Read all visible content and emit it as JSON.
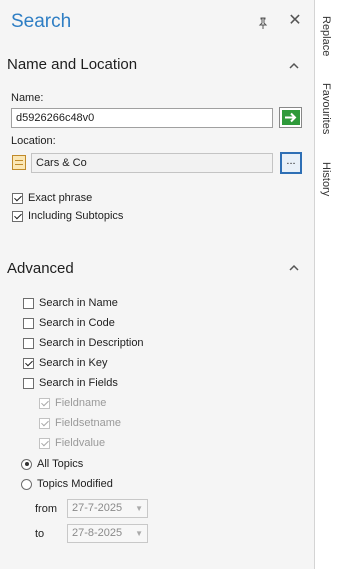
{
  "panel": {
    "title": "Search",
    "pin_icon": "pin-icon",
    "close_icon": "close-icon"
  },
  "side_tabs": [
    "Replace",
    "Favourites",
    "History"
  ],
  "name_location": {
    "heading": "Name and Location",
    "name_label": "Name:",
    "name_value": "d5926266c48v0",
    "location_label": "Location:",
    "location_value": "Cars & Co",
    "browse_label": "...",
    "options": [
      {
        "label": "Exact phrase",
        "checked": true
      },
      {
        "label": "Including Subtopics",
        "checked": true
      }
    ]
  },
  "advanced": {
    "heading": "Advanced",
    "search_in": [
      {
        "label": "Search in Name",
        "checked": false
      },
      {
        "label": "Search in Code",
        "checked": false
      },
      {
        "label": "Search in Description",
        "checked": false
      },
      {
        "label": "Search in Key",
        "checked": true
      },
      {
        "label": "Search in Fields",
        "checked": false
      }
    ],
    "fields": [
      {
        "label": "Fieldname",
        "checked": true
      },
      {
        "label": "Fieldsetname",
        "checked": true
      },
      {
        "label": "Fieldvalue",
        "checked": true
      }
    ],
    "topics": [
      {
        "label": "All Topics",
        "selected": true
      },
      {
        "label": "Topics Modified",
        "selected": false
      }
    ],
    "from_label": "from",
    "from_value": "27-7-2025",
    "to_label": "to",
    "to_value": "27-8-2025"
  },
  "colors": {
    "title": "#2e7ec4",
    "go_button": "#2e9a3a",
    "browse_border": "#2e6fb5"
  }
}
